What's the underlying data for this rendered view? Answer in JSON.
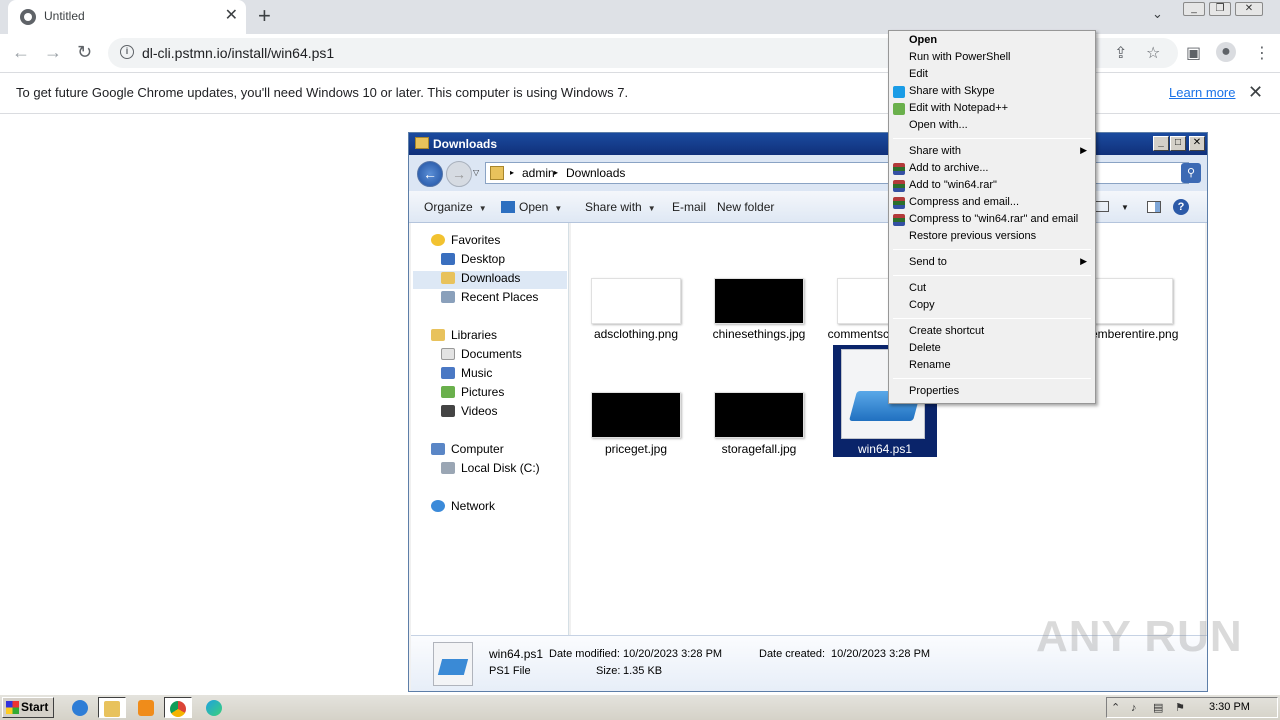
{
  "browser": {
    "tab_title": "Untitled",
    "url": "dl-cli.pstmn.io/install/win64.ps1",
    "infobar_message": "To get future Google Chrome updates, you'll need Windows 10 or later. This computer is using Windows 7.",
    "infobar_link": "Learn more"
  },
  "explorer": {
    "title": "Downloads",
    "breadcrumb": [
      "admin",
      "Downloads"
    ],
    "commands": [
      "Organize",
      "Open",
      "Share with",
      "E-mail",
      "New folder"
    ],
    "nav": {
      "favorites": "Favorites",
      "desktop": "Desktop",
      "downloads": "Downloads",
      "recent": "Recent Places",
      "libraries": "Libraries",
      "documents": "Documents",
      "music": "Music",
      "pictures": "Pictures",
      "videos": "Videos",
      "computer": "Computer",
      "local_disk": "Local Disk (C:)",
      "network": "Network"
    },
    "files": [
      {
        "name": "adsclothing.png",
        "thumb": "white",
        "caption": "adsclothing.png"
      },
      {
        "name": "chinesethings.jpg",
        "thumb": "black",
        "caption": "chinesethings.jpg"
      },
      {
        "name": "commentsc…",
        "thumb": "white",
        "caption": "commentsc"
      },
      {
        "name": "emberentire.png",
        "thumb": "white",
        "caption": "emberentire.png"
      },
      {
        "name": "priceget.jpg",
        "thumb": "black",
        "caption": "priceget.jpg"
      },
      {
        "name": "storagefall.jpg",
        "thumb": "black",
        "caption": "storagefall.jpg"
      },
      {
        "name": "win64.ps1",
        "thumb": "ps1",
        "caption": "win64.ps1",
        "selected": true
      }
    ],
    "details": {
      "name": "win64.ps1",
      "type": "PS1 File",
      "date_modified_label": "Date modified:",
      "date_modified": "10/20/2023 3:28 PM",
      "date_created_label": "Date created:",
      "date_created": "10/20/2023 3:28 PM",
      "size_label": "Size:",
      "size": "1.35 KB"
    }
  },
  "context_menu": {
    "open": "Open",
    "run_ps": "Run with PowerShell",
    "edit": "Edit",
    "share_skype": "Share with Skype",
    "edit_npp": "Edit with Notepad++",
    "open_with": "Open with...",
    "share_with": "Share with",
    "add_archive": "Add to archive...",
    "add_rar": "Add to \"win64.rar\"",
    "compress_email": "Compress and email...",
    "compress_rar_email": "Compress to \"win64.rar\" and email",
    "restore": "Restore previous versions",
    "send_to": "Send to",
    "cut": "Cut",
    "copy": "Copy",
    "create_shortcut": "Create shortcut",
    "delete": "Delete",
    "rename": "Rename",
    "properties": "Properties"
  },
  "taskbar": {
    "start": "Start",
    "clock": "3:30 PM"
  },
  "watermark": "ANY RUN"
}
